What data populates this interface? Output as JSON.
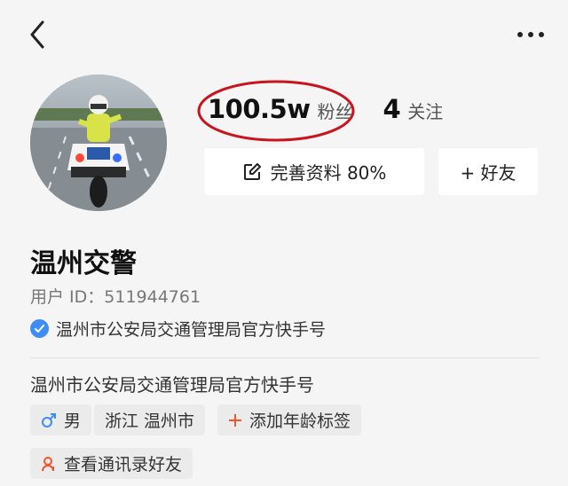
{
  "header": {
    "back_icon": "chevron-left-icon",
    "more_icon": "more-horizontal-icon"
  },
  "profile": {
    "avatar_icon": "motorcycle-police-avatar",
    "followers_count": "100.5w",
    "followers_label": "粉丝",
    "following_count": "4",
    "following_label": "关注",
    "edit_profile_label": "完善资料 80%",
    "add_friend_label": "+ 好友",
    "name": "温州交警",
    "user_id_label": "用户 ID：511944761",
    "verified_text": "温州市公安局交通管理局官方快手号",
    "bio": "温州市公安局交通管理局官方快手号",
    "tags": {
      "gender": "男",
      "location": "浙江 温州市",
      "add_age": "添加年龄标签",
      "contacts": "查看通讯录好友"
    }
  },
  "colors": {
    "background": "#f5f5f5",
    "highlight_circle": "#c8141c",
    "verified_badge": "#3d8df5",
    "accent_orange": "#f2552c",
    "gender_blue": "#3d8df5"
  }
}
